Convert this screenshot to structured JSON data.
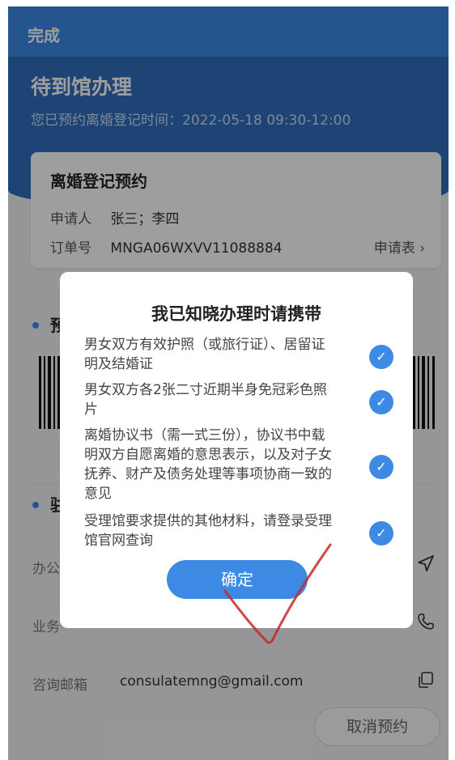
{
  "topbar": {
    "done_label": "完成"
  },
  "header": {
    "title": "待到馆办理",
    "subtitle": "您已预约离婚登记时间：2022-05-18 09:30-12:00"
  },
  "card": {
    "title": "离婚登记预约",
    "applicant_label": "申请人",
    "applicant_value": "张三；李四",
    "order_label": "订单号",
    "order_value": "MNGA06WXVV11088884",
    "apply_form_label": "申请表 ›"
  },
  "background": {
    "section1_char": "预",
    "section2_char": "驻",
    "rows": [
      {
        "key": "办公",
        "icon": "send-icon"
      },
      {
        "key": "业务",
        "icon": "phone-icon"
      }
    ],
    "email_label": "咨询邮箱",
    "email_value": "consulatemng@gmail.com",
    "cancel_label": "取消预约"
  },
  "modal": {
    "title": "我已知晓办理时请携带",
    "items": [
      {
        "text": "男女双方有效护照（或旅行证）、居留证明及结婚证",
        "checked": true
      },
      {
        "text": "男女双方各2张二寸近期半身免冠彩色照片",
        "checked": true
      },
      {
        "text": "离婚协议书（需一式三份），协议书中载明双方自愿离婚的意思表示，以及对子女抚养、财产及债务处理等事项协商一致的意见",
        "checked": true
      },
      {
        "text": "受理馆要求提供的其他材料，请登录受理馆官网查询",
        "checked": true
      }
    ],
    "confirm_label": "确定"
  },
  "colors": {
    "accent": "#3d8ae5",
    "header": "#2f6fbd",
    "annotation": "#c62828"
  }
}
